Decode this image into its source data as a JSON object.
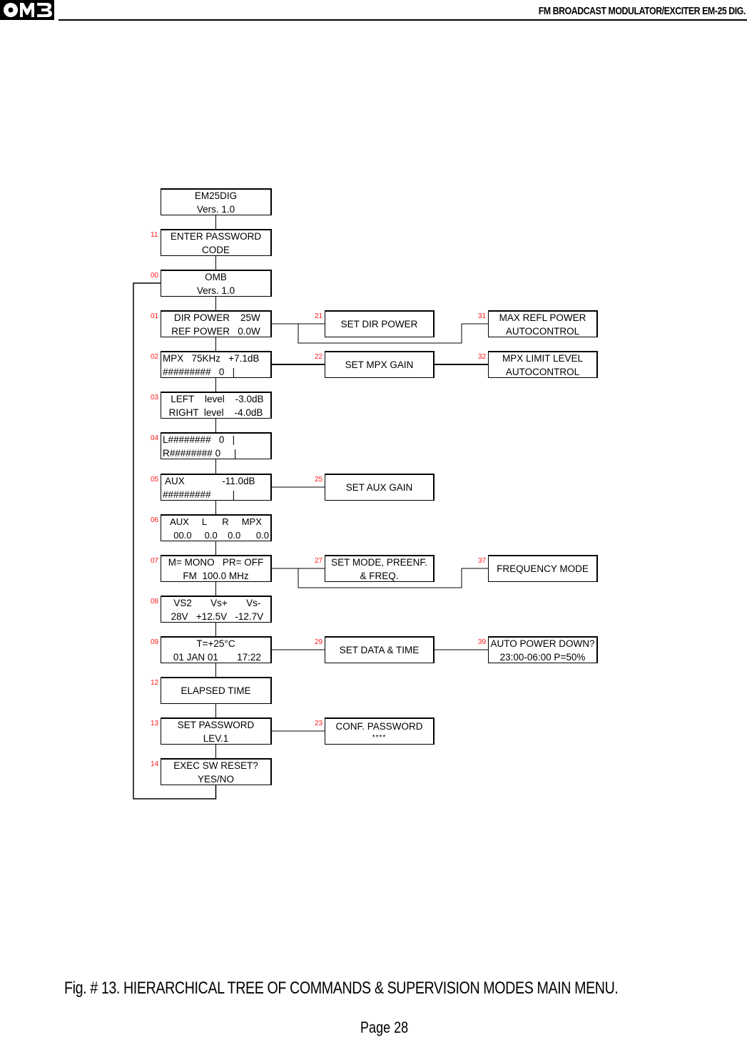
{
  "header": {
    "logo_text": "OMB",
    "title": "FM BROADCAST MODULATOR/EXCITER EM-25 DIG."
  },
  "diagram": {
    "nodes": [
      {
        "id": "em25dig",
        "code": "",
        "lines": [
          "EM25DIG",
          "Vers. 1.0"
        ]
      },
      {
        "id": "enter-password",
        "code": "11",
        "lines": [
          "ENTER PASSWORD",
          "CODE"
        ]
      },
      {
        "id": "omb-version",
        "code": "00",
        "lines": [
          "OMB",
          "Vers. 1.0"
        ]
      },
      {
        "id": "power",
        "code": "01",
        "lines": [
          " DIR POWER    25W",
          "REF POWER   0.0W"
        ]
      },
      {
        "id": "mpx",
        "code": "02",
        "lines": [
          "MPX   75KHz   +7.1dB",
          "#########   0   |"
        ]
      },
      {
        "id": "levels",
        "code": "03",
        "lines": [
          " LEFT    level    -3.0dB",
          "RIGHT  level    -4.0dB"
        ]
      },
      {
        "id": "lr-bars",
        "code": "04",
        "lines": [
          "L########   0   |",
          "R######## 0     |"
        ]
      },
      {
        "id": "aux",
        "code": "05",
        "lines": [
          " AUX              -11.0dB",
          "#########        |"
        ]
      },
      {
        "id": "meters",
        "code": "06",
        "lines": [
          "AUX     L      R     MPX",
          "00.0     0.0    0.0      0.0"
        ]
      },
      {
        "id": "mode",
        "code": "07",
        "lines": [
          "M= MONO   PR= OFF",
          "FM  100.0 MHz"
        ]
      },
      {
        "id": "voltages",
        "code": "08",
        "lines": [
          " VS2       Vs+       Vs-",
          " 28V   +12.5V   -12.7V"
        ]
      },
      {
        "id": "temp-date",
        "code": "09",
        "lines": [
          "T=+25°C",
          " 01 JAN 01       17:22"
        ]
      },
      {
        "id": "elapsed-time",
        "code": "12",
        "lines": [
          "ELAPSED TIME"
        ]
      },
      {
        "id": "set-password",
        "code": "13",
        "lines": [
          "SET PASSWORD",
          "LEV.1"
        ]
      },
      {
        "id": "sw-reset",
        "code": "14",
        "lines": [
          "EXEC SW RESET?",
          "YES/NO"
        ]
      },
      {
        "id": "set-dir-power",
        "code": "21",
        "lines": [
          "SET DIR POWER"
        ]
      },
      {
        "id": "set-mpx-gain",
        "code": "22",
        "lines": [
          "SET MPX GAIN"
        ]
      },
      {
        "id": "set-aux-gain",
        "code": "25",
        "lines": [
          "SET AUX GAIN"
        ]
      },
      {
        "id": "set-mode-freq",
        "code": "27",
        "lines": [
          "SET MODE, PREENF.",
          "& FREQ."
        ]
      },
      {
        "id": "set-data-time",
        "code": "29",
        "lines": [
          "SET DATA & TIME"
        ]
      },
      {
        "id": "conf-password",
        "code": "23",
        "lines": [
          "CONF. PASSWORD",
          "****"
        ]
      },
      {
        "id": "max-refl-power",
        "code": "31",
        "lines": [
          "MAX REFL POWER",
          "AUTOCONTROL"
        ]
      },
      {
        "id": "mpx-limit",
        "code": "32",
        "lines": [
          "MPX LIMIT LEVEL",
          "AUTOCONTROL"
        ]
      },
      {
        "id": "frequency-mode",
        "code": "37",
        "lines": [
          "FREQUENCY MODE"
        ]
      },
      {
        "id": "auto-power-down",
        "code": "39",
        "lines": [
          "AUTO POWER DOWN?",
          "23:00-06:00 P=50%"
        ]
      }
    ],
    "edges": [
      [
        "em25dig",
        "enter-password"
      ],
      [
        "enter-password",
        "omb-version"
      ],
      [
        "omb-version",
        "power"
      ],
      [
        "power",
        "mpx"
      ],
      [
        "mpx",
        "levels"
      ],
      [
        "levels",
        "lr-bars"
      ],
      [
        "lr-bars",
        "aux"
      ],
      [
        "aux",
        "meters"
      ],
      [
        "meters",
        "mode"
      ],
      [
        "mode",
        "voltages"
      ],
      [
        "voltages",
        "temp-date"
      ],
      [
        "temp-date",
        "elapsed-time"
      ],
      [
        "elapsed-time",
        "set-password"
      ],
      [
        "set-password",
        "sw-reset"
      ],
      [
        "sw-reset",
        "omb-version"
      ],
      [
        "power",
        "set-dir-power"
      ],
      [
        "power",
        "max-refl-power"
      ],
      [
        "mpx",
        "set-mpx-gain"
      ],
      [
        "set-mpx-gain",
        "mpx-limit"
      ],
      [
        "aux",
        "set-aux-gain"
      ],
      [
        "mode",
        "set-mode-freq"
      ],
      [
        "mode",
        "frequency-mode"
      ],
      [
        "temp-date",
        "set-data-time"
      ],
      [
        "set-data-time",
        "auto-power-down"
      ],
      [
        "set-password",
        "conf-password"
      ]
    ]
  },
  "caption": "Fig. # 13. HIERARCHICAL TREE OF COMMANDS  & SUPERVISION MODES MAIN MENU.",
  "page": "Page 28"
}
